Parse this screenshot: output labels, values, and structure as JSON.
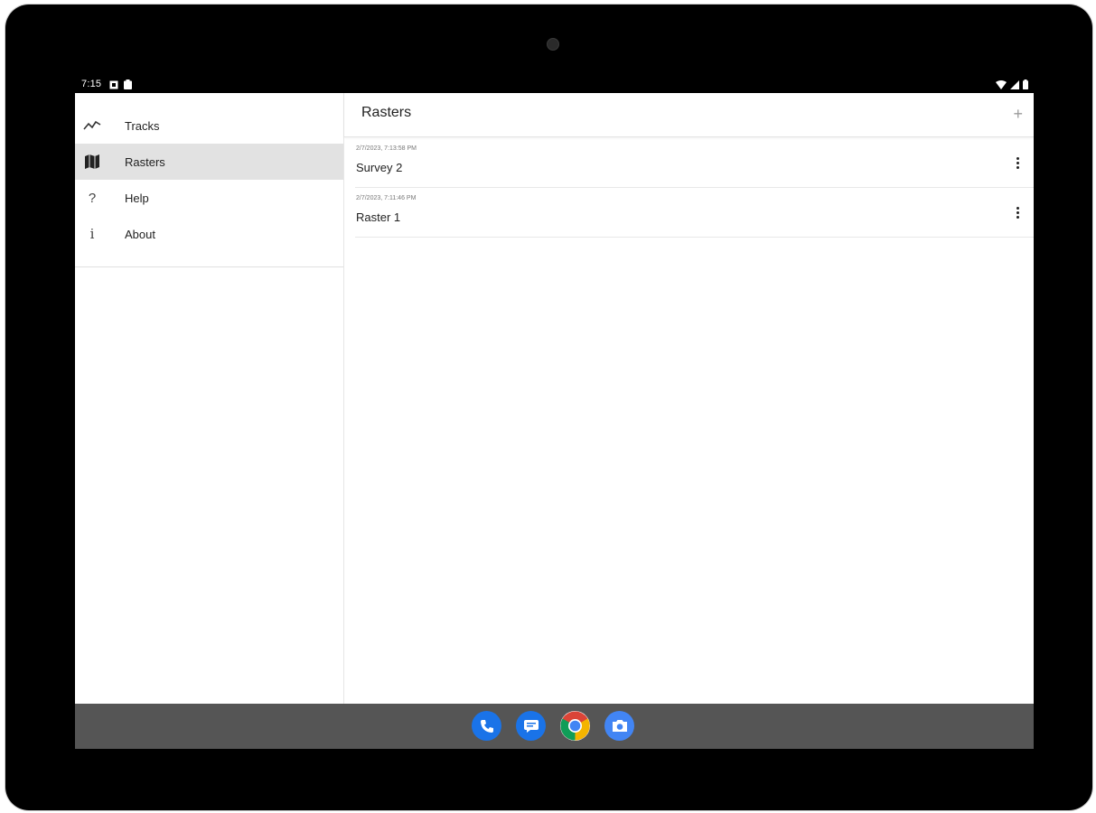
{
  "status": {
    "time": "7:15"
  },
  "drawer": {
    "items": [
      {
        "label": "Tracks",
        "icon": "tracks-icon",
        "active": false
      },
      {
        "label": "Rasters",
        "icon": "map-icon",
        "active": true
      },
      {
        "label": "Help",
        "icon": "help-icon",
        "active": false
      },
      {
        "label": "About",
        "icon": "info-icon",
        "active": false
      }
    ]
  },
  "toolbar": {
    "title": "Rasters",
    "add_label": "+"
  },
  "rasters": [
    {
      "date": "2/7/2023, 7:13:58 PM",
      "name": "Survey 2"
    },
    {
      "date": "2/7/2023, 7:11:46 PM",
      "name": "Raster 1"
    }
  ],
  "dock": [
    {
      "name": "phone-icon",
      "color": "#1a73e8"
    },
    {
      "name": "messages-icon",
      "color": "#1a73e8"
    },
    {
      "name": "chrome-icon",
      "color": "#ffffff"
    },
    {
      "name": "camera-icon",
      "color": "#4285f4"
    }
  ]
}
